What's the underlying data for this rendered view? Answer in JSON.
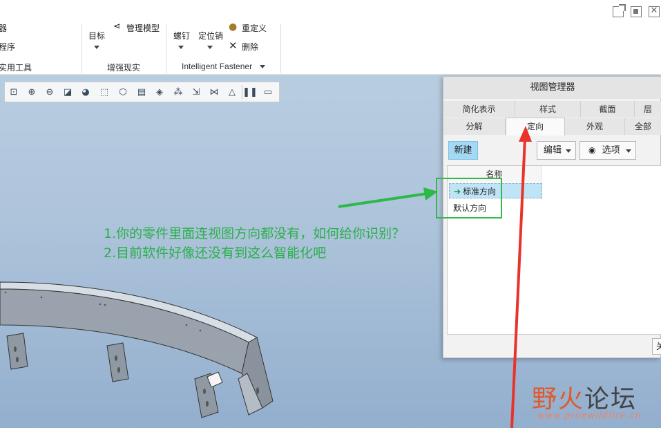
{
  "titlebar": {
    "buttons": [
      "external-window-icon",
      "maximize-icon",
      "close-icon"
    ],
    "close_glyph": "✕"
  },
  "ribbon": {
    "left_items": [
      "器",
      "程序",
      "实用工具"
    ],
    "group1": {
      "target_label": "目标",
      "manage_label": "管理模型",
      "group_label": "增强现实"
    },
    "group2": {
      "screw_label": "螺钉",
      "pin_label": "定位销",
      "redefine_label": "重定义",
      "delete_label": "删除",
      "group_label": "Intelligent Fastener"
    }
  },
  "toolbar": {
    "icons": [
      "zoom-fit-icon",
      "zoom-in-icon",
      "zoom-out-icon",
      "repaint-icon",
      "shading-icon",
      "wireframe-icon",
      "saved-views-icon",
      "layers-icon",
      "view-manager-icon",
      "datum-display-icon",
      "annotation-icon",
      "spin-center-icon",
      "display-style-icon",
      "pause-icon",
      "reorient-icon"
    ]
  },
  "annotation": {
    "line1": "1.你的零件里面连视图方向都没有，如何给你识别？",
    "line2": "2.目前软件好像还没有到这么智能化吧",
    "color": "#2ab04a"
  },
  "dialog": {
    "title": "视图管理器",
    "tabs_row1": [
      "简化表示",
      "样式",
      "截面",
      "层"
    ],
    "tabs_row2": [
      "分解",
      "定向",
      "外观",
      "全部"
    ],
    "active_tab": "定向",
    "new_button": "新建",
    "edit_dropdown": "编辑",
    "options_dropdown": "选项",
    "list_header": "名称",
    "items": [
      {
        "label": "标准方向",
        "selected": true
      },
      {
        "label": "默认方向",
        "selected": false
      }
    ],
    "bottom_button": "关"
  },
  "watermark": {
    "title_a": "野火",
    "title_b": "论坛",
    "url": "www.proewildfire.cn"
  },
  "colors": {
    "accent_green": "#2ab04a",
    "arrow_red": "#e8332a",
    "selection_blue": "#bfe4f8"
  }
}
